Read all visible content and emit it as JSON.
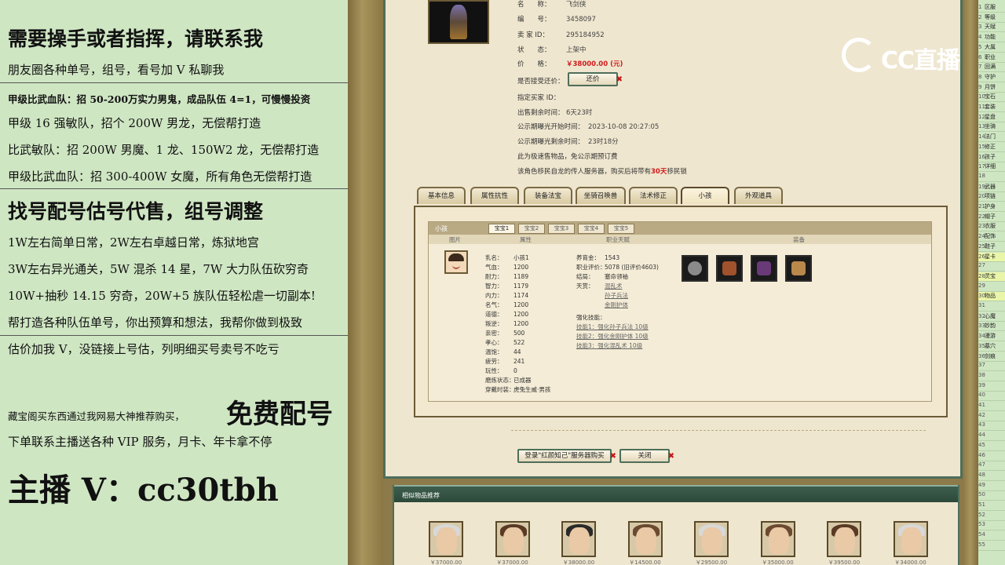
{
  "left_panel": {
    "lines": [
      "需要操手或者指挥，请联系我",
      "朋友圈各种单号，组号，看号加 V 私聊我",
      "甲级比武血队：招 50-200万实力男鬼，成品队伍 4=1，可慢慢投资",
      "甲级 16 强敏队，招个 200W 男龙，无偿帮打造",
      "比武敏队：招 200W 男魔、1 龙、150W2 龙，无偿帮打造",
      "甲级比武血队：招 300-400W 女魔，所有角色无偿帮打造",
      "找号配号估号代售，组号调整",
      "1W左右简单日常，2W左右卓越日常，炼狱地宫",
      "3W左右异光通关，5W 混杀 14 星，7W 大力队伍砍穷奇",
      "10W+抽秒 14.15 穷奇，20W+5 族队伍轻松虐一切副本!",
      "帮打造各种队伍单号，你出预算和想法，我帮你做到极致",
      "估价加我 V，没链接上号估，列明细买号卖号不吃亏",
      "藏宝阁买东西通过我网易大神推荐购买，",
      "免费配号",
      "下单联系主播送各种 VIP 服务，月卡、年卡拿不停",
      "主播 V：cc30tbh"
    ]
  },
  "info": {
    "name_key": "名　　称：",
    "name_val": "飞剑侠",
    "id_key": "编　　号：",
    "id_val": "3458097",
    "seller_key": "卖 家 ID：",
    "seller_val": "295184952",
    "status_key": "状　　态：",
    "status_val": "上架中",
    "price_key": "价　　格：",
    "price_val": "￥38000.00 (元)",
    "bargain_key": "是否接受还价：",
    "bargain_btn": "还价",
    "buyer_key": "指定买家 ID：",
    "buyer_val": "",
    "remain_key": "出售剩余时间：",
    "remain_val": "6天23时",
    "pub_start_key": "公示期曝光开始时间：",
    "pub_start_val": "2023-10-08 20:27:05",
    "pub_remain_key": "公示期曝光剩余时间：",
    "pub_remain_val": "23时18分",
    "note1": "此为极速售物品，免公示期预订费",
    "note2_a": "该角色移民自龙的传人服务器，购买后将带有",
    "note2_red": "30天",
    "note2_b": "移民锁"
  },
  "tabs": [
    "基本信息",
    "属性抗性",
    "装备法宝",
    "坐骑召唤兽",
    "法术修正",
    "小孩",
    "外观道具"
  ],
  "child_panel": {
    "title": "小孩",
    "subtabs": [
      "宝宝1",
      "宝宝2",
      "宝宝3",
      "宝宝4",
      "宝宝5"
    ],
    "col_image": "图片",
    "col_attr": "属性",
    "col_skill": "职业天赋",
    "col_equip": "装备",
    "attrs": [
      {
        "k": "乳名：",
        "v": "小孩1"
      },
      {
        "k": "气血：",
        "v": "1200"
      },
      {
        "k": "耐力：",
        "v": "1189"
      },
      {
        "k": "智力：",
        "v": "1179"
      },
      {
        "k": "内力：",
        "v": "1174"
      },
      {
        "k": "名气：",
        "v": "1200"
      },
      {
        "k": "道德：",
        "v": "1200"
      },
      {
        "k": "叛逆：",
        "v": "1200"
      },
      {
        "k": "亲密：",
        "v": "500"
      },
      {
        "k": "孝心：",
        "v": "522"
      },
      {
        "k": "温饱：",
        "v": "44"
      },
      {
        "k": "疲劳：",
        "v": "241"
      },
      {
        "k": "玩性：",
        "v": "0"
      },
      {
        "k": "磨炼状态：",
        "v": "已成器"
      },
      {
        "k": "穿戴时装：",
        "v": "虎兔生威·男孩"
      }
    ],
    "skills": {
      "gold_k": "养育金：",
      "gold_v": "1543",
      "eval_k": "职业评价：",
      "eval_v": "5078 (旧评价4603)",
      "end_k": "结局：",
      "end_v": "塞命领袖",
      "talent_k": "天赏：",
      "talents": [
        "混乱术",
        "孙子兵法",
        "金刚护体"
      ],
      "strength_k": "强化技能：",
      "strengths": [
        "技能1：强化孙子兵法 10级",
        "技能2：强化金刚护体 10级",
        "技能3：强化混乱术 10级"
      ]
    }
  },
  "buttons": {
    "login_buy": "登录\"红颜知己\"服务器购买",
    "close": "关闭"
  },
  "recommend": {
    "title": "相似物品推荐",
    "prices": [
      "￥37000.00",
      "￥37000.00",
      "￥38000.00",
      "￥14500.00",
      "￥29500.00",
      "￥35000.00",
      "￥39500.00",
      "￥34000.00"
    ]
  },
  "right_list": [
    "区服",
    "等级",
    "天赋",
    "功能",
    "大属",
    "职业",
    "回满",
    "守护",
    "月饼",
    "宝石",
    "套装",
    "星盘",
    "坐骑",
    "法门",
    "修正",
    "孩子",
    "详细",
    "",
    "武器",
    "项链",
    "护身",
    "帽子",
    "衣服",
    "配饰",
    "鞋子",
    "星卡",
    "",
    "灵宝",
    "",
    "物品",
    "",
    "心魔",
    "妙韵",
    "漫游",
    "墓穴",
    "剑痕",
    "",
    "",
    "",
    "",
    "",
    "",
    "",
    "",
    "",
    "",
    "",
    "",
    "",
    "",
    "",
    "",
    "",
    "",
    ""
  ],
  "right_list_numbers": [
    "1",
    "2",
    "3",
    "4",
    "5",
    "6",
    "7",
    "8",
    "9",
    "10",
    "11",
    "12",
    "13",
    "14",
    "15",
    "16",
    "17",
    "18",
    "19",
    "20",
    "21",
    "22",
    "23",
    "24",
    "25",
    "26",
    "27",
    "28",
    "29",
    "30",
    "31",
    "32",
    "33",
    "34",
    "35",
    "36",
    "37",
    "38",
    "39",
    "40",
    "41",
    "42",
    "43",
    "44",
    "45",
    "46",
    "47",
    "48",
    "49",
    "50",
    "51",
    "52",
    "53",
    "54",
    "55"
  ],
  "logo": {
    "text": "CC直播"
  },
  "colors": {
    "accent_green": "#4e6e5a",
    "price_red": "#d01b1b",
    "panel_green": "#cfe6c3"
  }
}
